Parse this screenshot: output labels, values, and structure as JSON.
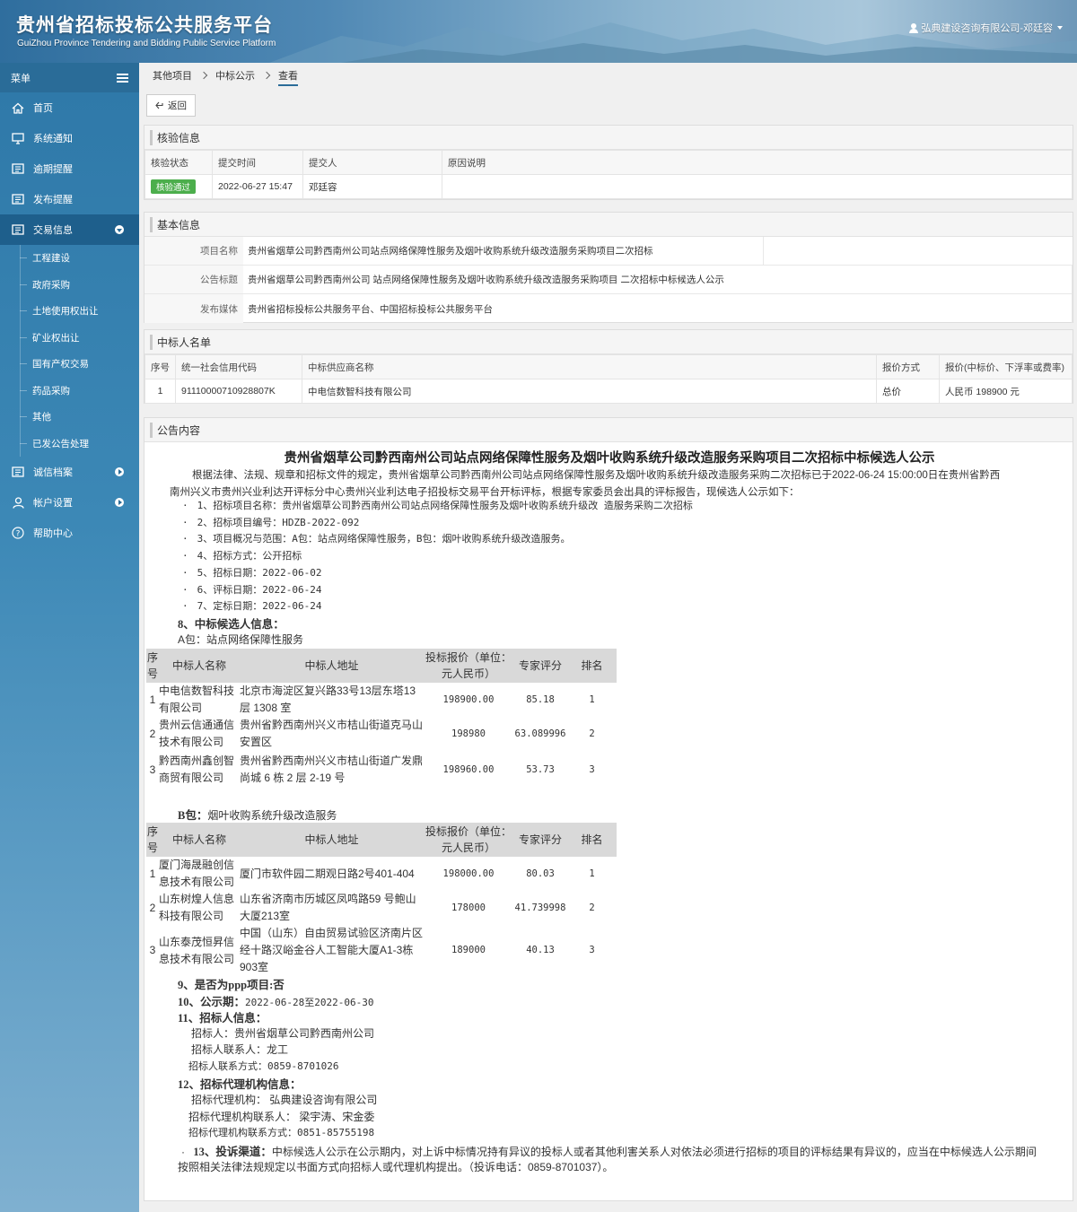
{
  "header": {
    "title": "贵州省招标投标公共服务平台",
    "subtitle": "GuiZhou Province Tendering and Bidding Public Service Platform",
    "user": "弘典建设咨询有限公司-邓廷容"
  },
  "sidebar": {
    "menu_label": "菜单",
    "items": [
      {
        "label": "首页",
        "icon": "home-icon"
      },
      {
        "label": "系统通知",
        "icon": "monitor-icon"
      },
      {
        "label": "逾期提醒",
        "icon": "list-icon"
      },
      {
        "label": "发布提醒",
        "icon": "list-icon"
      },
      {
        "label": "交易信息",
        "icon": "list-icon"
      }
    ],
    "sub_items": [
      "工程建设",
      "政府采购",
      "土地使用权出让",
      "矿业权出让",
      "国有产权交易",
      "药品采购",
      "其他",
      "已发公告处理"
    ],
    "bottom_items": [
      {
        "label": "诚信档案",
        "icon": "list-icon"
      },
      {
        "label": "帐户设置",
        "icon": "user-icon"
      },
      {
        "label": "帮助中心",
        "icon": "help-icon"
      }
    ]
  },
  "breadcrumb": [
    "其他项目",
    "中标公示",
    "查看"
  ],
  "back_label": "返回",
  "verify": {
    "title": "核验信息",
    "headers": [
      "核验状态",
      "提交时间",
      "提交人",
      "原因说明"
    ],
    "status": "核验通过",
    "time": "2022-06-27 15:47",
    "submitter": "邓廷容",
    "reason": ""
  },
  "basic": {
    "title": "基本信息",
    "rows": [
      {
        "key": "项目名称",
        "value": "贵州省烟草公司黔西南州公司站点网络保障性服务及烟叶收购系统升级改造服务采购项目二次招标"
      },
      {
        "key": "公告标题",
        "value": "贵州省烟草公司黔西南州公司 站点网络保障性服务及烟叶收购系统升级改造服务采购项目 二次招标中标候选人公示"
      },
      {
        "key": "发布媒体",
        "value": "贵州省招标投标公共服务平台、中国招标投标公共服务平台"
      }
    ]
  },
  "winners": {
    "title": "中标人名单",
    "headers": [
      "序号",
      "统一社会信用代码",
      "中标供应商名称",
      "报价方式",
      "报价(中标价、下浮率或费率)"
    ],
    "rows": [
      {
        "no": "1",
        "code": "91110000710928807K",
        "name": "中电信数智科技有限公司",
        "mode": "总价",
        "price": "人民币 198900 元"
      }
    ]
  },
  "announcement": {
    "panel_title": "公告内容",
    "title": "贵州省烟草公司黔西南州公司站点网络保障性服务及烟叶收购系统升级改造服务采购项目二次招标中标候选人公示",
    "intro1": "根据法律、法规、规章和招标文件的规定，贵州省烟草公司黔西南州公司站点网络保障性服务及烟叶收购系统升级改造服务采购二次招标已于2022-06-24  15:00:00日在贵州省黔西",
    "intro2": "南州兴义市贵州兴业利达开评标分中心贵州兴业利达电子招投标交易平台开标评标，根据专家委员会出具的评标报告，现候选人公示如下：",
    "items": [
      "1、招标项目名称：贵州省烟草公司黔西南州公司站点网络保障性服务及烟叶收购系统升级改   造服务采购二次招标",
      "2、招标项目编号：HDZB-2022-092",
      "3、项目概况与范围：A包：站点网络保障性服务，B包：烟叶收购系统升级改造服务。",
      "4、招标方式：公开招标",
      "5、招标日期：2022-06-02",
      "6、评标日期：2022-06-24",
      "7、定标日期：2022-06-24"
    ],
    "sec8": "8、中标候选人信息：",
    "packA": "A包：站点网络保障性服务",
    "packB_prefix": "B包：",
    "packB": "烟叶收购系统升级改造服务",
    "cand_headers": [
      "序号",
      "中标人名称",
      "中标人地址",
      "投标报价（单位：元人民币）",
      "专家评分",
      "排名"
    ],
    "tableA": [
      {
        "no": "1",
        "name": "中电信数智科技有限公司",
        "addr": "北京市海淀区复兴路33号13层东塔13层 1308 室",
        "price": "198900.00",
        "score": "85.18",
        "rank": "1"
      },
      {
        "no": "2",
        "name": "贵州云信通通信技术有限公司",
        "addr": "贵州省黔西南州兴义市桔山街道克马山安置区",
        "price": "198980",
        "score": "63.089996",
        "rank": "2"
      },
      {
        "no": "3",
        "name": "黔西南州鑫创智商贸有限公司",
        "addr": "贵州省黔西南州兴义市桔山街道广发鼎尚城 6 栋 2 层 2-19 号",
        "price": "198960.00",
        "score": "53.73",
        "rank": "3"
      }
    ],
    "tableB": [
      {
        "no": "1",
        "name": "厦门海晟融创信息技术有限公司",
        "addr": "厦门市软件园二期观日路2号401-404",
        "price": "198000.00",
        "score": "80.03",
        "rank": "1"
      },
      {
        "no": "2",
        "name": "山东树煌人信息科技有限公司",
        "addr": "山东省济南市历城区凤鸣路59 号鲍山大厦213室",
        "price": "178000",
        "score": "41.739998",
        "rank": "2"
      },
      {
        "no": "3",
        "name": "山东泰茂恒昇信息技术有限公司",
        "addr": "中国（山东）自由贸易试验区济南片区经十路汉峪金谷人工智能大厦A1-3栋903室",
        "price": "189000",
        "score": "40.13",
        "rank": "3"
      }
    ],
    "sec9": "9、是否为ppp项目:否",
    "sec10_label": "10、公示期：",
    "sec10_value": "2022-06-28至2022-06-30",
    "sec11": "11、招标人信息：",
    "tenderer": "招标人：贵州省烟草公司黔西南州公司",
    "tenderer_contact": "招标人联系人：龙工",
    "tenderer_phone": "招标人联系方式：0859-8701026",
    "sec12": "12、招标代理机构信息：",
    "agent": "招标代理机构：  弘典建设咨询有限公司",
    "agent_contact": "招标代理机构联系人：  梁宇涛、宋金委",
    "agent_phone": "招标代理机构联系方式：0851-85755198",
    "sec13_label": "13、投诉渠道：",
    "sec13_text1": "中标候选人公示在公示期内，对上诉中标情况持有异议的投标人或者其他利害关系人对依法必须进行招标的项目的评标结果有异议的，应当在中标候选人公示期间",
    "sec13_text2": "按照相关法律法规规定以书面方式向招标人或代理机构提出。（投诉电话：0859-8701037）。"
  }
}
